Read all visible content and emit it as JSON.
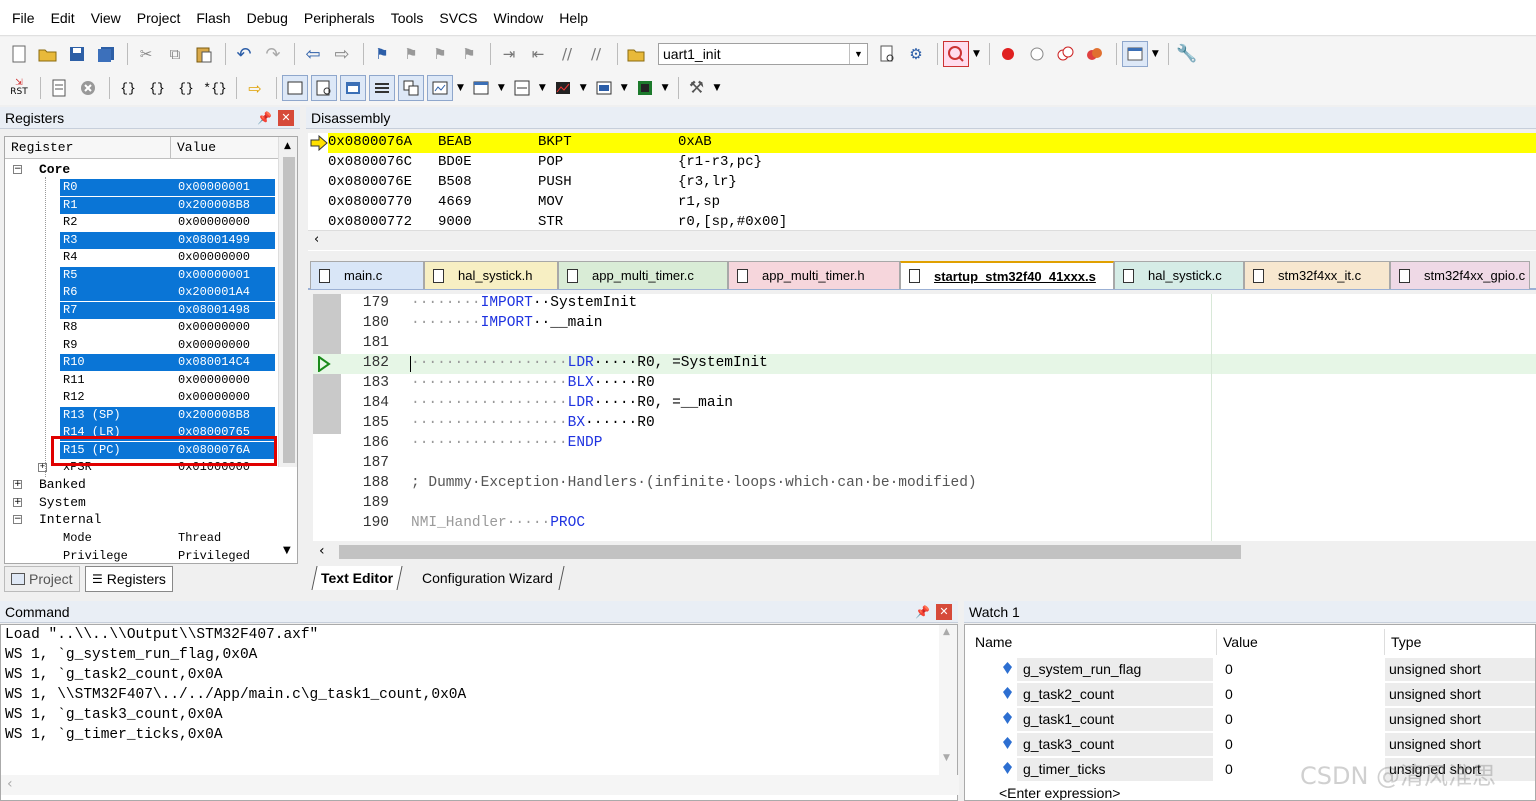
{
  "menu": [
    "File",
    "Edit",
    "View",
    "Project",
    "Flash",
    "Debug",
    "Peripherals",
    "Tools",
    "SVCS",
    "Window",
    "Help"
  ],
  "toolbar1": {
    "target_combo": "uart1_init"
  },
  "toolbar2": {
    "rst_label": "RST"
  },
  "registers_panel": {
    "title": "Registers",
    "col_register": "Register",
    "col_value": "Value",
    "core_label": "Core",
    "rows": [
      {
        "name": "R0",
        "value": "0x00000001",
        "selected": true
      },
      {
        "name": "R1",
        "value": "0x200008B8",
        "selected": true
      },
      {
        "name": "R2",
        "value": "0x00000000",
        "selected": false
      },
      {
        "name": "R3",
        "value": "0x08001499",
        "selected": true
      },
      {
        "name": "R4",
        "value": "0x00000000",
        "selected": false
      },
      {
        "name": "R5",
        "value": "0x00000001",
        "selected": true
      },
      {
        "name": "R6",
        "value": "0x200001A4",
        "selected": true
      },
      {
        "name": "R7",
        "value": "0x08001498",
        "selected": true
      },
      {
        "name": "R8",
        "value": "0x00000000",
        "selected": false
      },
      {
        "name": "R9",
        "value": "0x00000000",
        "selected": false
      },
      {
        "name": "R10",
        "value": "0x080014C4",
        "selected": true
      },
      {
        "name": "R11",
        "value": "0x00000000",
        "selected": false
      },
      {
        "name": "R12",
        "value": "0x00000000",
        "selected": false
      },
      {
        "name": "R13 (SP)",
        "value": "0x200008B8",
        "selected": true
      },
      {
        "name": "R14 (LR)",
        "value": "0x08000765",
        "selected": true
      },
      {
        "name": "R15 (PC)",
        "value": "0x0800076A",
        "selected": true
      },
      {
        "name": "xPSR",
        "value": "0x01000000",
        "selected": false
      }
    ],
    "groups": [
      "Banked",
      "System",
      "Internal"
    ],
    "internal_rows": [
      {
        "name": "Mode",
        "value": "Thread"
      },
      {
        "name": "Privilege",
        "value": "Privileged"
      }
    ],
    "tab_project": "Project",
    "tab_registers": "Registers"
  },
  "disassembly": {
    "title": "Disassembly",
    "lines": [
      {
        "addr": "0x0800076A",
        "op": "BEAB",
        "mn": "BKPT",
        "args": "0xAB",
        "current": true
      },
      {
        "addr": "0x0800076C",
        "op": "BD0E",
        "mn": "POP",
        "args": "{r1-r3,pc}",
        "current": false
      },
      {
        "addr": "0x0800076E",
        "op": "B508",
        "mn": "PUSH",
        "args": "{r3,lr}",
        "current": false
      },
      {
        "addr": "0x08000770",
        "op": "4669",
        "mn": "MOV",
        "args": "r1,sp",
        "current": false
      },
      {
        "addr": "0x08000772",
        "op": "9000",
        "mn": "STR",
        "args": "r0,[sp,#0x00]",
        "current": false
      }
    ]
  },
  "file_tabs": [
    {
      "label": "main.c",
      "color": "#d9e6f7",
      "active": false
    },
    {
      "label": "hal_systick.h",
      "color": "#f7efc3",
      "active": false
    },
    {
      "label": "app_multi_timer.c",
      "color": "#d9ecd6",
      "active": false
    },
    {
      "label": "app_multi_timer.h",
      "color": "#f6d6dc",
      "active": false
    },
    {
      "label": "startup_stm32f40_41xxx.s",
      "color": "#e3dcef",
      "active": true
    },
    {
      "label": "hal_systick.c",
      "color": "#d5ece6",
      "active": false
    },
    {
      "label": "stm32f4xx_it.c",
      "color": "#f7e7cf",
      "active": false
    },
    {
      "label": "stm32f4xx_gpio.c",
      "color": "#efd9e6",
      "active": false
    }
  ],
  "editor": {
    "lines": [
      {
        "num": "179",
        "dots": "········",
        "kw": "IMPORT",
        "rest": "··SystemInit"
      },
      {
        "num": "180",
        "dots": "········",
        "kw": "IMPORT",
        "rest": "··__main"
      },
      {
        "num": "181",
        "dots": "",
        "kw": "",
        "rest": ""
      },
      {
        "num": "182",
        "dots": "··················",
        "kw": "LDR",
        "rest": "·····R0, =SystemInit"
      },
      {
        "num": "183",
        "dots": "··················",
        "kw": "BLX",
        "rest": "·····R0"
      },
      {
        "num": "184",
        "dots": "··················",
        "kw": "LDR",
        "rest": "·····R0, =__main"
      },
      {
        "num": "185",
        "dots": "··················",
        "kw": "BX",
        "rest": "······R0"
      },
      {
        "num": "186",
        "dots": "··················",
        "kw": "ENDP",
        "rest": ""
      },
      {
        "num": "187",
        "dots": "",
        "kw": "",
        "rest": ""
      },
      {
        "num": "188",
        "dots": "",
        "kw": "",
        "rest": "; Dummy·Exception·Handlers·(infinite·loops·which·can·be·modified)"
      },
      {
        "num": "189",
        "dots": "",
        "kw": "",
        "rest": ""
      },
      {
        "num": "190",
        "dots": "NMI_Handler·····",
        "kw": "PROC",
        "rest": ""
      }
    ],
    "bottom_tab_editor": "Text Editor",
    "bottom_tab_wizard": "Configuration Wizard"
  },
  "command": {
    "title": "Command",
    "lines": [
      "Load \"..\\\\..\\\\Output\\\\STM32F407.axf\"",
      "WS 1, `g_system_run_flag,0x0A",
      "WS 1, `g_task2_count,0x0A",
      "WS 1, \\\\STM32F407\\../../App/main.c\\g_task1_count,0x0A",
      "WS 1, `g_task3_count,0x0A",
      "WS 1, `g_timer_ticks,0x0A"
    ]
  },
  "watch": {
    "title": "Watch 1",
    "col_name": "Name",
    "col_value": "Value",
    "col_type": "Type",
    "rows": [
      {
        "name": "g_system_run_flag",
        "value": "0",
        "type": "unsigned short"
      },
      {
        "name": "g_task2_count",
        "value": "0",
        "type": "unsigned short"
      },
      {
        "name": "g_task1_count",
        "value": "0",
        "type": "unsigned short"
      },
      {
        "name": "g_task3_count",
        "value": "0",
        "type": "unsigned short"
      },
      {
        "name": "g_timer_ticks",
        "value": "0",
        "type": "unsigned short"
      }
    ],
    "enter_expression": "<Enter expression>"
  },
  "watermark": "CSDN @清风淮思"
}
